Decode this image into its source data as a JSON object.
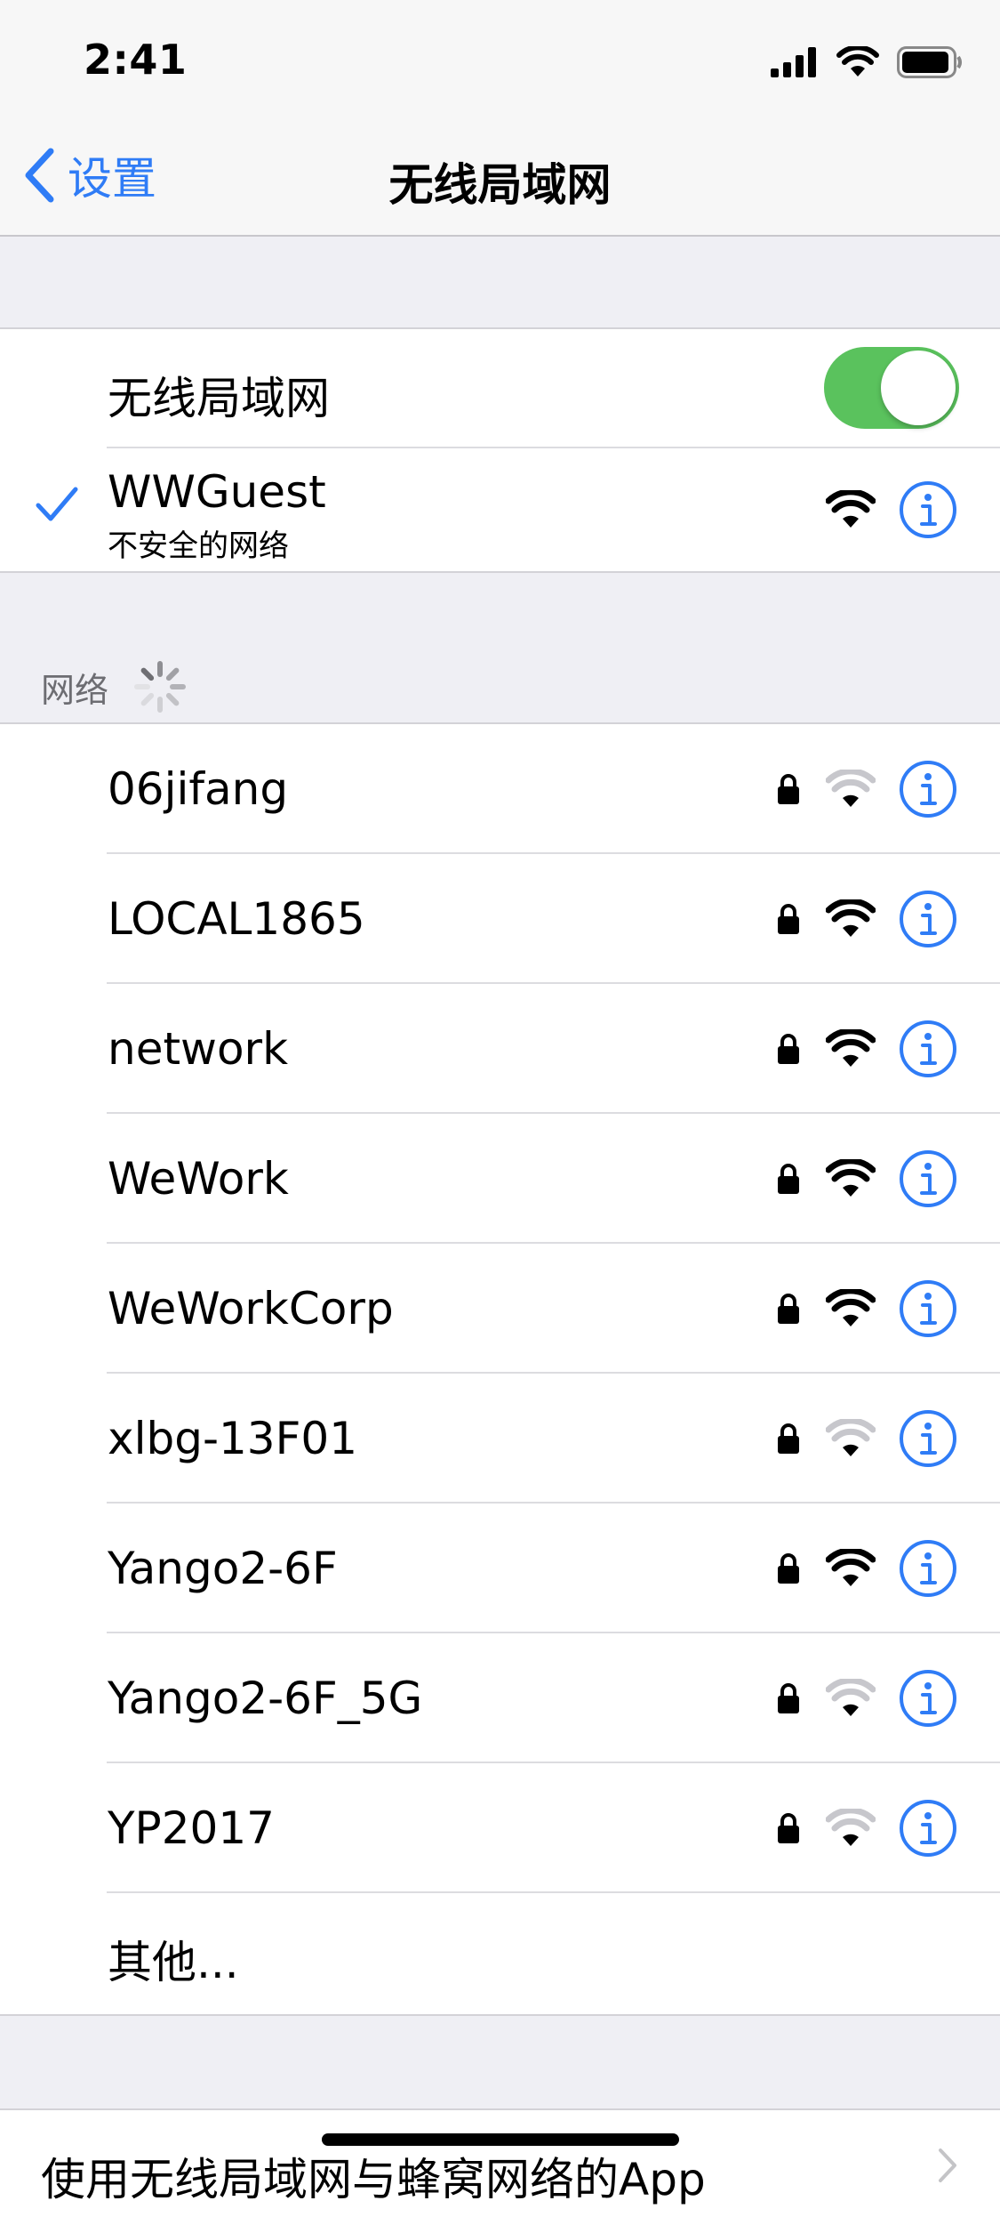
{
  "status_bar": {
    "time": "2:41"
  },
  "nav": {
    "back_label": "设置",
    "title": "无线局域网"
  },
  "wifi_toggle": {
    "label": "无线局域网",
    "enabled": true
  },
  "connected": {
    "name": "WWGuest",
    "subtitle": "不安全的网络"
  },
  "networks_header": "网络",
  "networks": [
    {
      "name": "06jifang",
      "strength": "low"
    },
    {
      "name": "LOCAL1865",
      "strength": "high"
    },
    {
      "name": "network",
      "strength": "high"
    },
    {
      "name": "WeWork",
      "strength": "high"
    },
    {
      "name": "WeWorkCorp",
      "strength": "high"
    },
    {
      "name": "xlbg-13F01",
      "strength": "low"
    },
    {
      "name": "Yango2-6F",
      "strength": "high"
    },
    {
      "name": "Yango2-6F_5G",
      "strength": "low"
    },
    {
      "name": "YP2017",
      "strength": "low"
    }
  ],
  "other_label": "其他...",
  "apps_row_label": "使用无线局域网与蜂窝网络的App",
  "colors": {
    "accent": "#2f7cf6",
    "toggle_on": "#5ac25d"
  }
}
